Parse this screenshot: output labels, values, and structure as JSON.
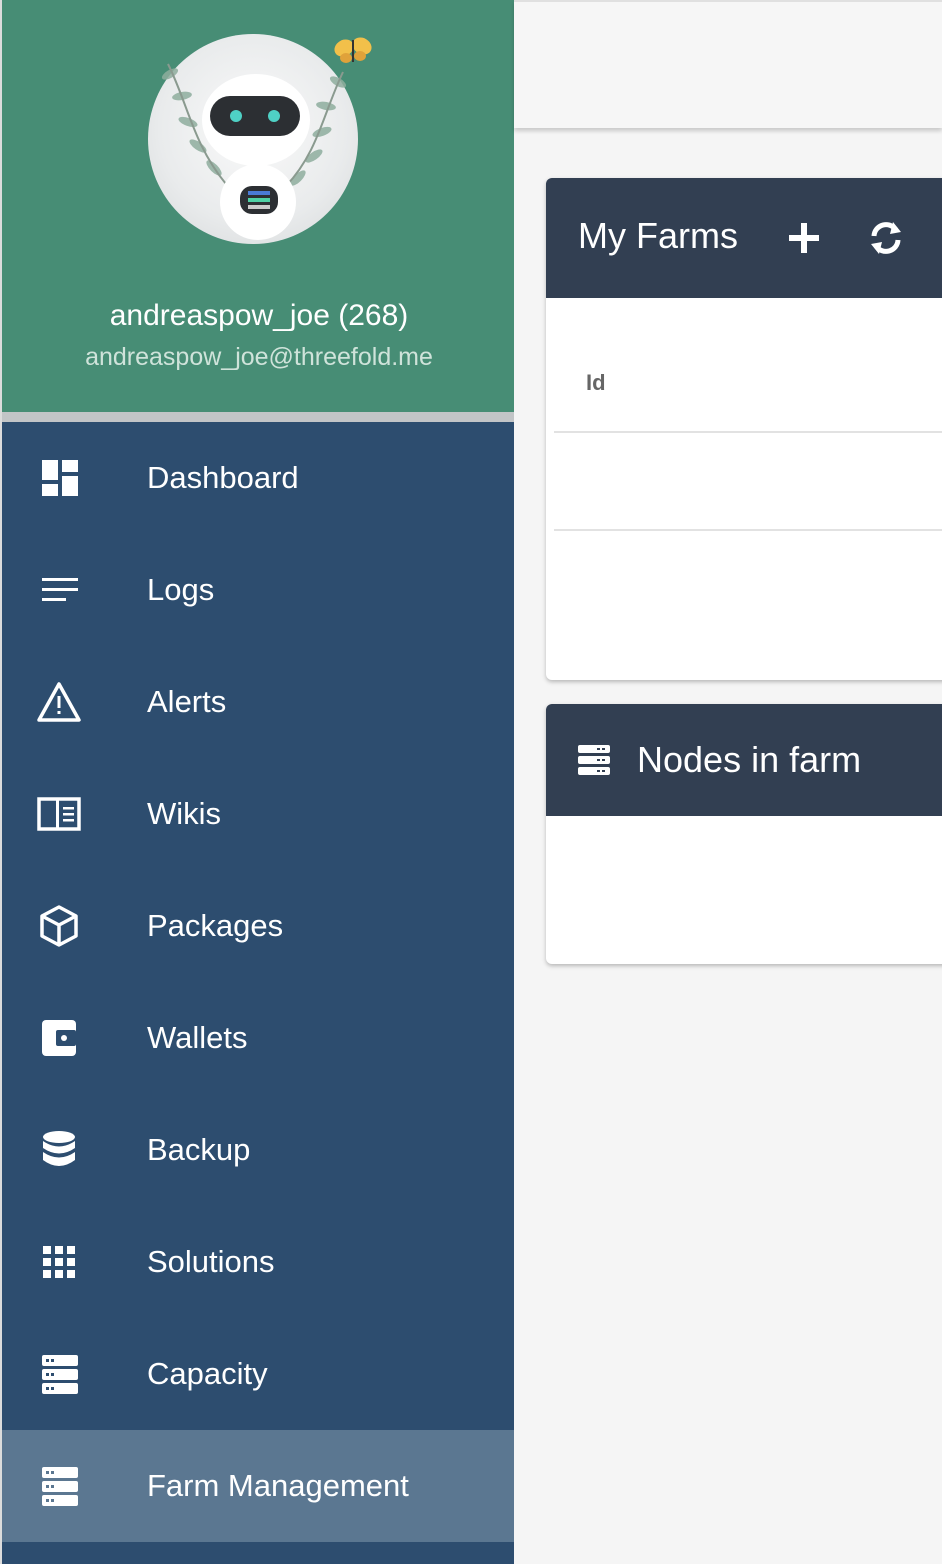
{
  "profile": {
    "name": "andreaspow_joe (268)",
    "email": "andreaspow_joe@threefold.me"
  },
  "sidebar": {
    "items": [
      {
        "label": "Dashboard",
        "icon": "dashboard-icon"
      },
      {
        "label": "Logs",
        "icon": "logs-icon"
      },
      {
        "label": "Alerts",
        "icon": "alert-triangle-icon"
      },
      {
        "label": "Wikis",
        "icon": "book-icon"
      },
      {
        "label": "Packages",
        "icon": "package-box-icon"
      },
      {
        "label": "Wallets",
        "icon": "wallet-icon"
      },
      {
        "label": "Backup",
        "icon": "database-icon"
      },
      {
        "label": "Solutions",
        "icon": "apps-grid-icon"
      },
      {
        "label": "Capacity",
        "icon": "server-icon"
      },
      {
        "label": "Farm Management",
        "icon": "server-icon"
      }
    ],
    "active": "Farm Management"
  },
  "farms": {
    "title": "My Farms",
    "add_icon": "plus-icon",
    "refresh_icon": "refresh-icon",
    "columns": [
      "Id"
    ]
  },
  "nodes": {
    "title": "Nodes in farm",
    "icon": "server-icon"
  },
  "colors": {
    "sidebar": "#2d4d6f",
    "profile_bg": "#478d75",
    "active_item": "#5b7791",
    "card_header": "#323f52"
  }
}
